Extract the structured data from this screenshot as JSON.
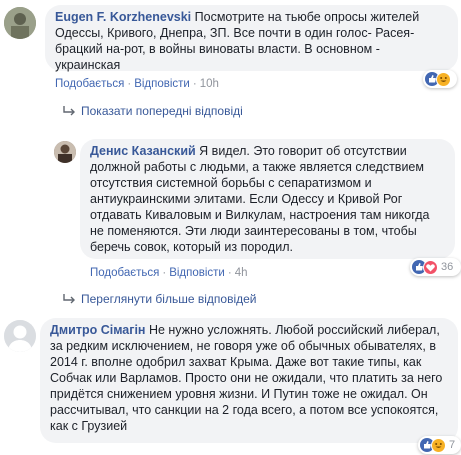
{
  "comments": [
    {
      "author": "Eugen F. Korzhenevski",
      "text": "Посмотрите на тьюбе опросы жителей Одессы, Кривого, Днепра, ЗП. Все почти в один голос- Расея-брацкий на-рот, в войны виноваты власти. В основном - украинская",
      "like_label": "Подобається",
      "reply_label": "Відповісти",
      "time": "10h",
      "reaction_count": ""
    },
    {
      "author": "Денис Казанский",
      "text": "Я видел. Это говорит об отсутствии должной работы с людьми, а также является следствием отсутствия системной борьбы с сепаратизмом и антиукраинскими элитами. Если Одессу и Кривой Рог отдавать Киваловым и Вилкулам, настроения там никогда не поменяются. Эти люди заинтересованы в том, чтобы беречь совок, который из породил.",
      "like_label": "Подобається",
      "reply_label": "Відповісти",
      "time": "4h",
      "reaction_count": "36"
    },
    {
      "author": "Дмитро Сімагін",
      "text": "Не нужно усложнять. Любой российский либерал, за редким исключением, не говоря уже об обычных обывателях, в 2014 г. вполне одобрил захват Крыма. Даже вот такие типы, как Собчак или Варламов. Просто они не ожидали, что платить за него придётся снижением уровня жизни. И Путин тоже не ожидал. Он рассчитывал, что санкции на 2 года всего, а потом все успокоятся, как с Грузией",
      "reaction_count": "7"
    }
  ],
  "links": {
    "show_previous": "Показати попередні відповіді",
    "show_more": "Переглянути більше відповідей"
  },
  "colors": {
    "like": "#4267b2",
    "love": "#f25268",
    "haha": "#f7b125",
    "link": "#385898",
    "bubble": "#f2f3f5"
  }
}
